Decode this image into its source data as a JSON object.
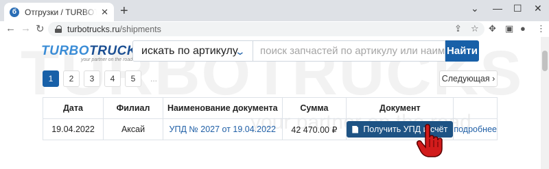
{
  "browser": {
    "tab_title": "Отгрузки / TURBOTRUCKS — запчасти",
    "favicon": "б",
    "url_domain": "turbotrucks.ru",
    "url_path": "/shipments"
  },
  "site": {
    "brand_part1": "TURBO",
    "brand_part2": "TRUCKS",
    "tagline": "your partner on the road",
    "watermark": "TURBOTRUCKS",
    "watermark_tagline": "your partner on the road",
    "accent_color": "#1860a8"
  },
  "search": {
    "select_value": "искать по артикулу",
    "placeholder": "поиск запчастей по артикулу или наименованию",
    "button_label": "Найти"
  },
  "pagination": {
    "pages": [
      "1",
      "2",
      "3",
      "4",
      "5"
    ],
    "ellipsis": "...",
    "active_page": "1",
    "next_label": "Следующая ›"
  },
  "table": {
    "headers": [
      "Дата",
      "Филиал",
      "Наименование документа",
      "Сумма",
      "Документ",
      ""
    ],
    "rows": [
      {
        "date": "19.04.2022",
        "branch": "Аксай",
        "doc_name": "УПД № 2027 от 19.04.2022",
        "sum": "42 470.00 ₽",
        "doc_button": "Получить УПД и счёт",
        "more": "подробнее"
      }
    ]
  }
}
